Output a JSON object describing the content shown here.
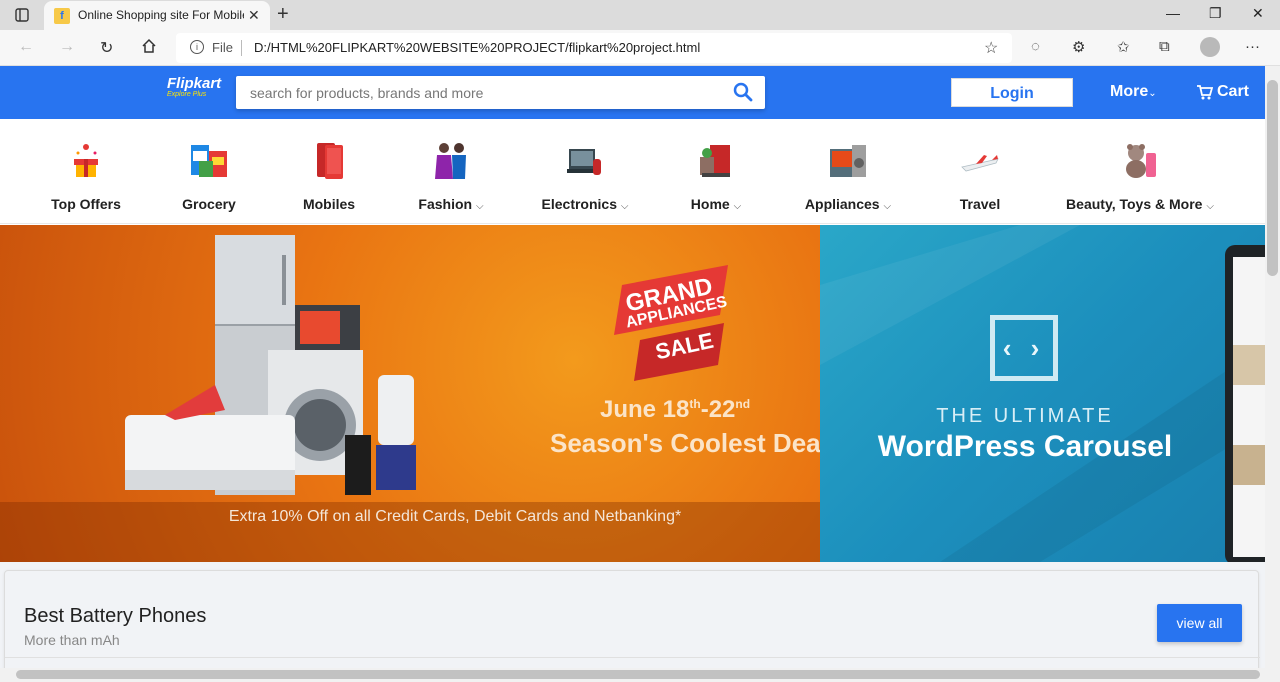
{
  "browser": {
    "tab_title": "Online Shopping site For Mobile",
    "url_scheme": "File",
    "url": "D:/HTML%20FLIPKART%20WEBSITE%20PROJECT/flipkart%20project.html"
  },
  "header": {
    "logo_main": "Flipkart",
    "logo_sub": "Explore Plus",
    "search_placeholder": "search for products, brands and more",
    "login_label": "Login",
    "more_label": "More",
    "cart_label": "Cart"
  },
  "categories": [
    {
      "label": "Top Offers",
      "dropdown": false
    },
    {
      "label": "Grocery",
      "dropdown": false
    },
    {
      "label": "Mobiles",
      "dropdown": false
    },
    {
      "label": "Fashion",
      "dropdown": true
    },
    {
      "label": "Electronics",
      "dropdown": true
    },
    {
      "label": "Home",
      "dropdown": true
    },
    {
      "label": "Appliances",
      "dropdown": true
    },
    {
      "label": "Travel",
      "dropdown": false
    },
    {
      "label": "Beauty, Toys & More",
      "dropdown": true
    }
  ],
  "banner_left": {
    "badge_line1": "GRAND",
    "badge_line2": "APPLIANCES",
    "badge_line3": "SALE",
    "date": "June 18th-22nd",
    "date_main": "June 18",
    "date_sup1": "th",
    "date_mid": "-22",
    "date_sup2": "nd",
    "tagline": "Season's Coolest Deals",
    "offer": "Extra 10% Off on all Credit Cards, Debit Cards and Netbanking*"
  },
  "banner_right": {
    "code_symbol": "‹ ›",
    "line1": "THE ULTIMATE",
    "line2": "WordPress Carousel"
  },
  "section": {
    "title": "Best Battery Phones",
    "subtitle": "More than mAh",
    "view_all": "view all"
  },
  "colors": {
    "brand": "#2874f0",
    "accent_yellow": "#ffe500"
  }
}
